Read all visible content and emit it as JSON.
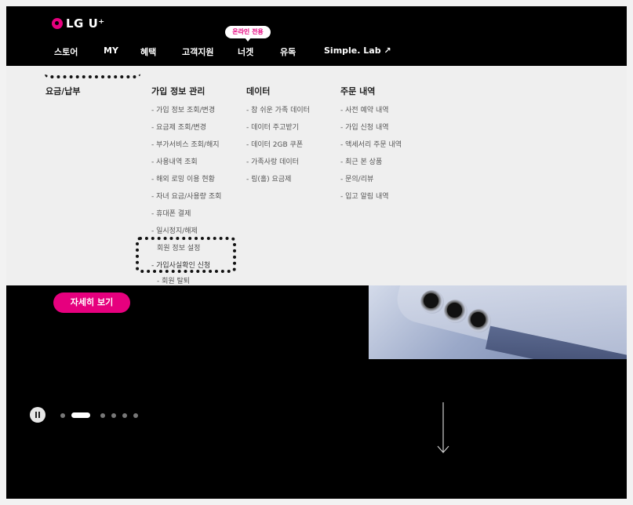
{
  "brand": {
    "logo_text": "LG U⁺",
    "accent": "#e6007e"
  },
  "nav": {
    "items": [
      "스토어",
      "MY",
      "혜택",
      "고객지원",
      "너겟",
      "유독",
      "Simple. Lab ↗"
    ],
    "badge": "온라인 전용"
  },
  "menu": {
    "col0": {
      "heading": "요금/납부"
    },
    "col1": {
      "heading": "가입 정보 관리",
      "items": [
        "- 가입 정보 조회/변경",
        "- 요금제 조회/변경",
        "- 부가서비스 조회/해지",
        "- 사용내역 조회",
        "- 해외 로밍 이용 현황",
        "- 자녀 요금/사용량 조회",
        "- 휴대폰 결제",
        "- 일시정지/해제",
        "회원 정보 설정",
        "- 가입사실확인 신청",
        "- 회원 탈퇴"
      ]
    },
    "col2": {
      "heading": "데이터",
      "items": [
        "- 참 쉬운 가족 데이터",
        "- 데이터 주고받기",
        "- 데이터 2GB 쿠폰",
        "- 가족사랑 데이터",
        "- 링(홀) 요금제"
      ]
    },
    "col3": {
      "heading": "주문 내역",
      "items": [
        "- 사전 예약 내역",
        "- 가입 신청 내역",
        "- 액세서리 주문 내역",
        "- 최근 본 상품",
        "- 문의/리뷰",
        "- 입고 알림 내역"
      ]
    }
  },
  "hero": {
    "detail_button": "자세히 보기"
  },
  "carousel": {
    "slide_count": 6,
    "active_index": 1
  },
  "icons": {
    "pause": "pause-icon",
    "scroll": "arrow-down-icon"
  }
}
